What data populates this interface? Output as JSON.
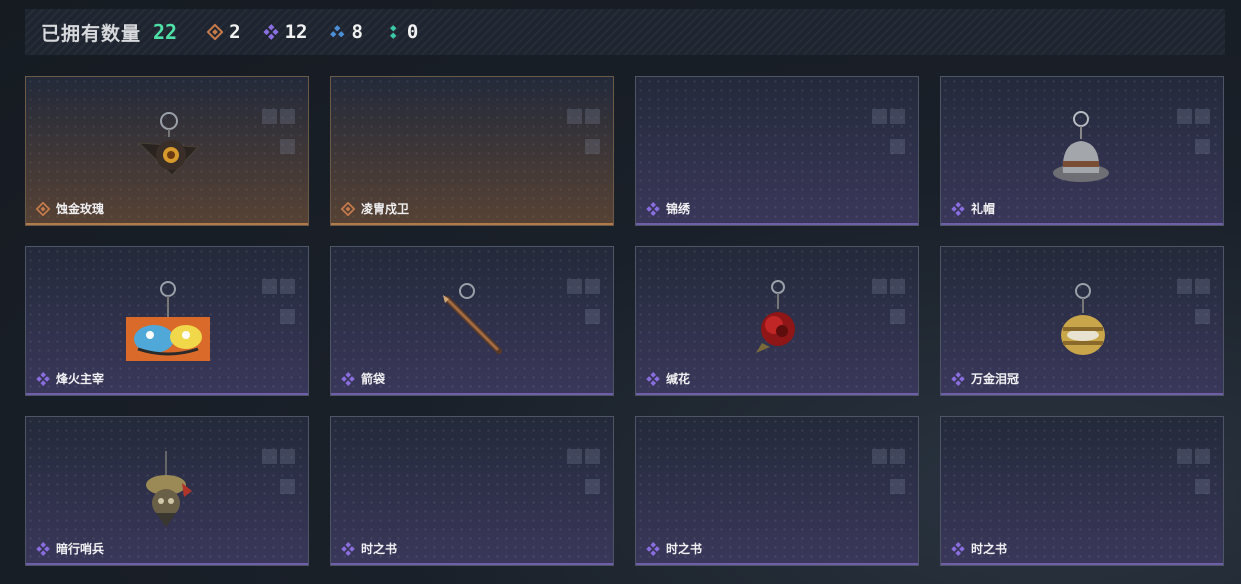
{
  "header": {
    "title": "已拥有数量",
    "total": "22",
    "stats": [
      {
        "icon": "gold-rarity-icon",
        "value": "2"
      },
      {
        "icon": "purple-rarity-icon",
        "value": "12"
      },
      {
        "icon": "blue-rarity-icon",
        "value": "8"
      },
      {
        "icon": "green-rarity-icon",
        "value": "0"
      }
    ]
  },
  "colors": {
    "gold": "#c77b4a",
    "purple": "#8a6ee0",
    "blue": "#4c8fd6",
    "green": "#3cc9a8",
    "total": "#4fe0a8"
  },
  "cards": [
    {
      "name": "蚀金玫瑰",
      "rarity": "gold",
      "charm": "rose-charm"
    },
    {
      "name": "凌冑戍卫",
      "rarity": "gold",
      "charm": "none"
    },
    {
      "name": "锦绣",
      "rarity": "purple",
      "charm": "none"
    },
    {
      "name": "礼帽",
      "rarity": "purple",
      "charm": "hat-charm"
    },
    {
      "name": "烽火主宰",
      "rarity": "purple",
      "charm": "graffiti-charm"
    },
    {
      "name": "箭袋",
      "rarity": "purple",
      "charm": "quiver-charm"
    },
    {
      "name": "缄花",
      "rarity": "purple",
      "charm": "red-rose-charm"
    },
    {
      "name": "万金泪冠",
      "rarity": "purple",
      "charm": "crown-charm"
    },
    {
      "name": "暗行哨兵",
      "rarity": "purple",
      "charm": "sentinel-charm"
    },
    {
      "name": "时之书",
      "rarity": "purple",
      "charm": "none"
    },
    {
      "name": "时之书",
      "rarity": "purple",
      "charm": "none"
    },
    {
      "name": "时之书",
      "rarity": "purple",
      "charm": "none"
    }
  ]
}
